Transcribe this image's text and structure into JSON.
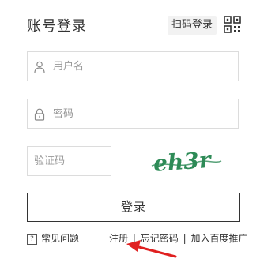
{
  "header": {
    "title": "账号登录",
    "qr_login_label": "扫码登录"
  },
  "form": {
    "username_placeholder": "用户名",
    "password_placeholder": "密码",
    "captcha_placeholder": "验证码",
    "captcha_text": "eh3r",
    "login_button_label": "登录"
  },
  "footer": {
    "faq_label": "常见问题",
    "register_label": "注册",
    "forgot_password_label": "忘记密码",
    "join_baidu_promo_label": "加入百度推广",
    "separator": "|"
  },
  "colors": {
    "annotation_arrow": "#e02020",
    "captcha_ink": "#2e8b57"
  }
}
